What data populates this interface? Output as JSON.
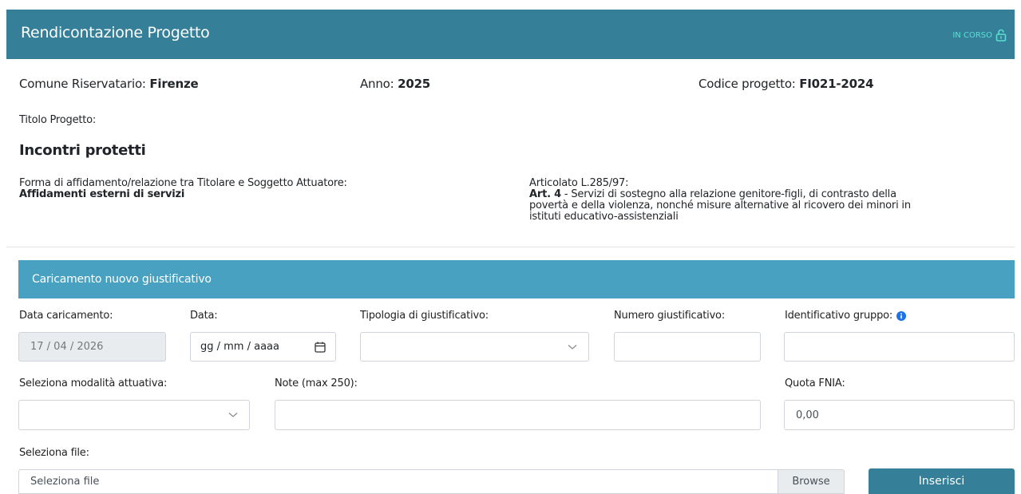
{
  "header": {
    "title": "Rendicontazione Progetto",
    "status": "IN CORSO",
    "status_icon": "unlock-icon"
  },
  "info": {
    "comune_label": "Comune Riservatario:",
    "comune_value": "Firenze",
    "anno_label": "Anno:",
    "anno_value": "2025",
    "codice_label": "Codice progetto:",
    "codice_value": "FI021-2024",
    "titolo_label": "Titolo Progetto:",
    "titolo_value": "Incontri protetti",
    "forma_label": "Forma di affidamento/relazione tra Titolare e Soggetto Attuatore:",
    "forma_value": "Affidamenti esterni di servizi",
    "articolato_label": "Articolato L.285/97:",
    "articolo_value": "Art. 4",
    "articolo_desc_1": " - Servizi di sostegno alla relazione genitore-figli, di contrasto della",
    "articolo_desc_2": "povertà e della violenza, nonché misure alternative al ricovero dei minori in",
    "articolo_desc_3": "istituti educativo-assistenziali"
  },
  "form": {
    "section_title": "Caricamento nuovo giustificativo",
    "data_caricamento_label": "Data caricamento:",
    "data_caricamento_value": "17 / 04 / 2026",
    "data_label": "Data:",
    "data_placeholder": "gg / mm / aaaa",
    "tipologia_label": "Tipologia di giustificativo:",
    "tipologia_value": "",
    "numero_label": "Numero giustificativo:",
    "numero_value": "",
    "identificativo_label": "Identificativo gruppo:",
    "identificativo_value": "",
    "modalita_label": "Seleziona modalità attuativa:",
    "modalita_value": "",
    "note_label": "Note (max 250):",
    "note_value": "",
    "quota_label": "Quota FNIA:",
    "quota_value": "0,00",
    "file_label": "Seleziona file:",
    "file_placeholder": "Seleziona file",
    "browse_label": "Browse",
    "insert_label": "Inserisci"
  },
  "colors": {
    "header_bg": "#367f98",
    "section_bg": "#49a1c1",
    "status": "#59e0d2",
    "info_icon": "#1a73e8"
  }
}
